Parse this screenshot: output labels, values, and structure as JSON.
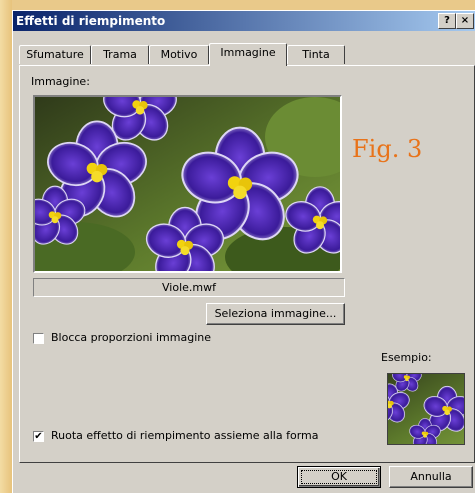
{
  "window": {
    "title": "Effetti di riempimento",
    "help_label": "?",
    "close_label": "×"
  },
  "tabs": [
    {
      "label": "Sfumature"
    },
    {
      "label": "Trama"
    },
    {
      "label": "Motivo"
    },
    {
      "label": "Immagine",
      "active": true
    },
    {
      "label": "Tinta"
    }
  ],
  "image_section": {
    "label": "Immagine:",
    "filename": "Viole.mwf"
  },
  "buttons": {
    "select_image": "Seleziona immagine...",
    "ok": "OK",
    "cancel": "Annulla"
  },
  "checkboxes": {
    "lock_aspect": {
      "label": "Blocca proporzioni immagine",
      "checked": false
    },
    "rotate_fill": {
      "label": "Ruota effetto di riempimento assieme alla forma",
      "checked": true
    }
  },
  "preview": {
    "label": "Esempio:"
  },
  "annotation": {
    "text": "Fig. 3",
    "color": "#e8731a"
  },
  "colors": {
    "titlebar_start": "#0a246a",
    "dialog_bg": "#d4d0c8"
  }
}
